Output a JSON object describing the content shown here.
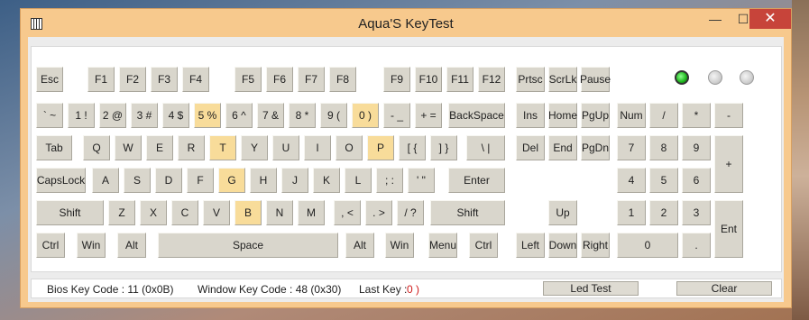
{
  "window": {
    "title": "Aqua'S KeyTest",
    "minimize_glyph": "—",
    "maximize_glyph": "☐",
    "close_glyph": "✕"
  },
  "highlight_color": "#f8dc9a",
  "keys": {
    "esc": "Esc",
    "f1": "F1",
    "f2": "F2",
    "f3": "F3",
    "f4": "F4",
    "f5": "F5",
    "f6": "F6",
    "f7": "F7",
    "f8": "F8",
    "f9": "F9",
    "f10": "F10",
    "f11": "F11",
    "f12": "F12",
    "prtsc": "Prtsc",
    "scrlk": "ScrLk",
    "pause": "Pause",
    "backtick": "` ~",
    "n1": "1 !",
    "n2": "2 @",
    "n3": "3 #",
    "n4": "4 $",
    "n5": "5 %",
    "n6": "6 ^",
    "n7": "7 &",
    "n8": "8 *",
    "n9": "9 (",
    "n0": "0 )",
    "minus": "- _",
    "equals": "+ =",
    "backspace": "BackSpace",
    "ins": "Ins",
    "home": "Home",
    "pgup": "PgUp",
    "numlock": "Num",
    "num_div": "/",
    "num_mul": "*",
    "num_sub": "-",
    "tab": "Tab",
    "q": "Q",
    "w": "W",
    "e": "E",
    "r": "R",
    "t": "T",
    "y": "Y",
    "u": "U",
    "i": "I",
    "o": "O",
    "p": "P",
    "lbracket": "[ {",
    "rbracket": "] }",
    "backslash": "\\ |",
    "del": "Del",
    "end": "End",
    "pgdn": "PgDn",
    "num7": "7",
    "num8": "8",
    "num9": "9",
    "num_add": "+",
    "capslock": "CapsLock",
    "a": "A",
    "s": "S",
    "d": "D",
    "f": "F",
    "g": "G",
    "h": "H",
    "j": "J",
    "k": "K",
    "l": "L",
    "semicolon": "; :",
    "quote": "' \"",
    "enter": "Enter",
    "num4": "4",
    "num5": "5",
    "num6": "6",
    "lshift": "Shift",
    "z": "Z",
    "x": "X",
    "c": "C",
    "v": "V",
    "b": "B",
    "n": "N",
    "m": "M",
    "comma": ", <",
    "period": ". >",
    "slash": "/ ?",
    "rshift": "Shift",
    "up": "Up",
    "num1": "1",
    "num2": "2",
    "num3": "3",
    "num_enter": "Ent",
    "lctrl": "Ctrl",
    "lwin": "Win",
    "lalt": "Alt",
    "space": "Space",
    "ralt": "Alt",
    "rwin": "Win",
    "menu": "Menu",
    "rctrl": "Ctrl",
    "left": "Left",
    "down": "Down",
    "right": "Right",
    "num0": "0",
    "num_dot": "."
  },
  "highlighted_keys": [
    "n5",
    "n0",
    "t",
    "p",
    "g",
    "b"
  ],
  "leds": {
    "num_lock": true,
    "caps_lock": false,
    "scroll_lock": false
  },
  "status": {
    "bios_key_code": "Bios Key Code : 11 (0x0B)",
    "window_key_code": "Window Key Code : 48 (0x30)",
    "last_key_label": "Last Key :",
    "last_key_value": "0 )",
    "led_test": "Led Test",
    "clear": "Clear"
  }
}
